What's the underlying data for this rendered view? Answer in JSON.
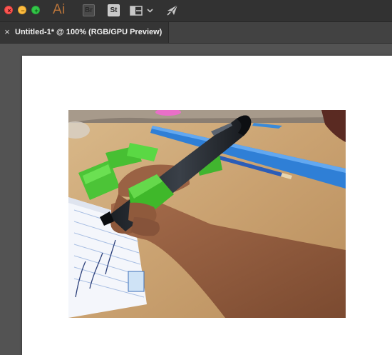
{
  "window": {
    "close_glyph": "×",
    "minimize_glyph": "−",
    "maximize_glyph": "+",
    "colors": {
      "close": "#fc5753",
      "minimize": "#fdbc40",
      "maximize": "#33c748"
    }
  },
  "appbar": {
    "app_logo": "Ai",
    "bridge_label": "Br",
    "stock_label": "St",
    "icons": [
      "window-close-icon",
      "window-minimize-icon",
      "window-maximize-icon",
      "layout-grid-icon",
      "chevron-down-icon",
      "send-paper-plane-icon"
    ],
    "accent": "#b9743a"
  },
  "document_tab": {
    "close_glyph": "×",
    "title": "Untitled-1* @ 100% (RGB/GPU Preview)"
  },
  "canvas": {
    "background": "#535353",
    "artboard_color": "#ffffff",
    "placed_image_subject": "hand-holding-stylus-with-green-3d-printed-grip-photo"
  }
}
